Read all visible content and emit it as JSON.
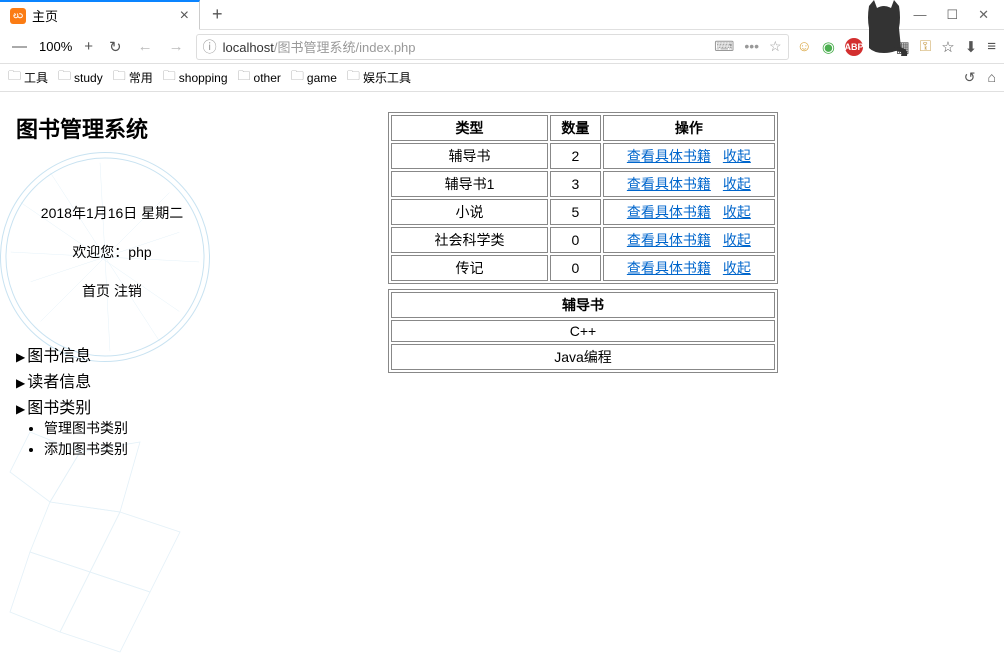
{
  "browser": {
    "tab_title": "主页",
    "zoom": "100%",
    "address_host": "localhost",
    "address_path": "/图书管理系统/index.php"
  },
  "bookmarks": [
    "工具",
    "study",
    "常用",
    "shopping",
    "other",
    "game",
    "娱乐工具"
  ],
  "sidebar": {
    "title": "图书管理系统",
    "date": "2018年1月16日 星期二",
    "welcome": "欢迎您：php",
    "link_home": "首页",
    "link_logout": "注销",
    "menu": [
      {
        "label": "图书信息",
        "children": []
      },
      {
        "label": "读者信息",
        "children": []
      },
      {
        "label": "图书类别",
        "children": [
          "管理图书类别",
          "添加图书类别"
        ]
      }
    ]
  },
  "table": {
    "headers": {
      "type": "类型",
      "qty": "数量",
      "action": "操作"
    },
    "action_view": "查看具体书籍",
    "action_collapse": "收起",
    "rows": [
      {
        "type": "辅导书",
        "qty": "2"
      },
      {
        "type": "辅导书1",
        "qty": "3"
      },
      {
        "type": "小说",
        "qty": "5"
      },
      {
        "type": "社会科学类",
        "qty": "0"
      },
      {
        "type": "传记",
        "qty": "0"
      }
    ]
  },
  "detail": {
    "header": "辅导书",
    "items": [
      "C++",
      "Java编程"
    ]
  }
}
